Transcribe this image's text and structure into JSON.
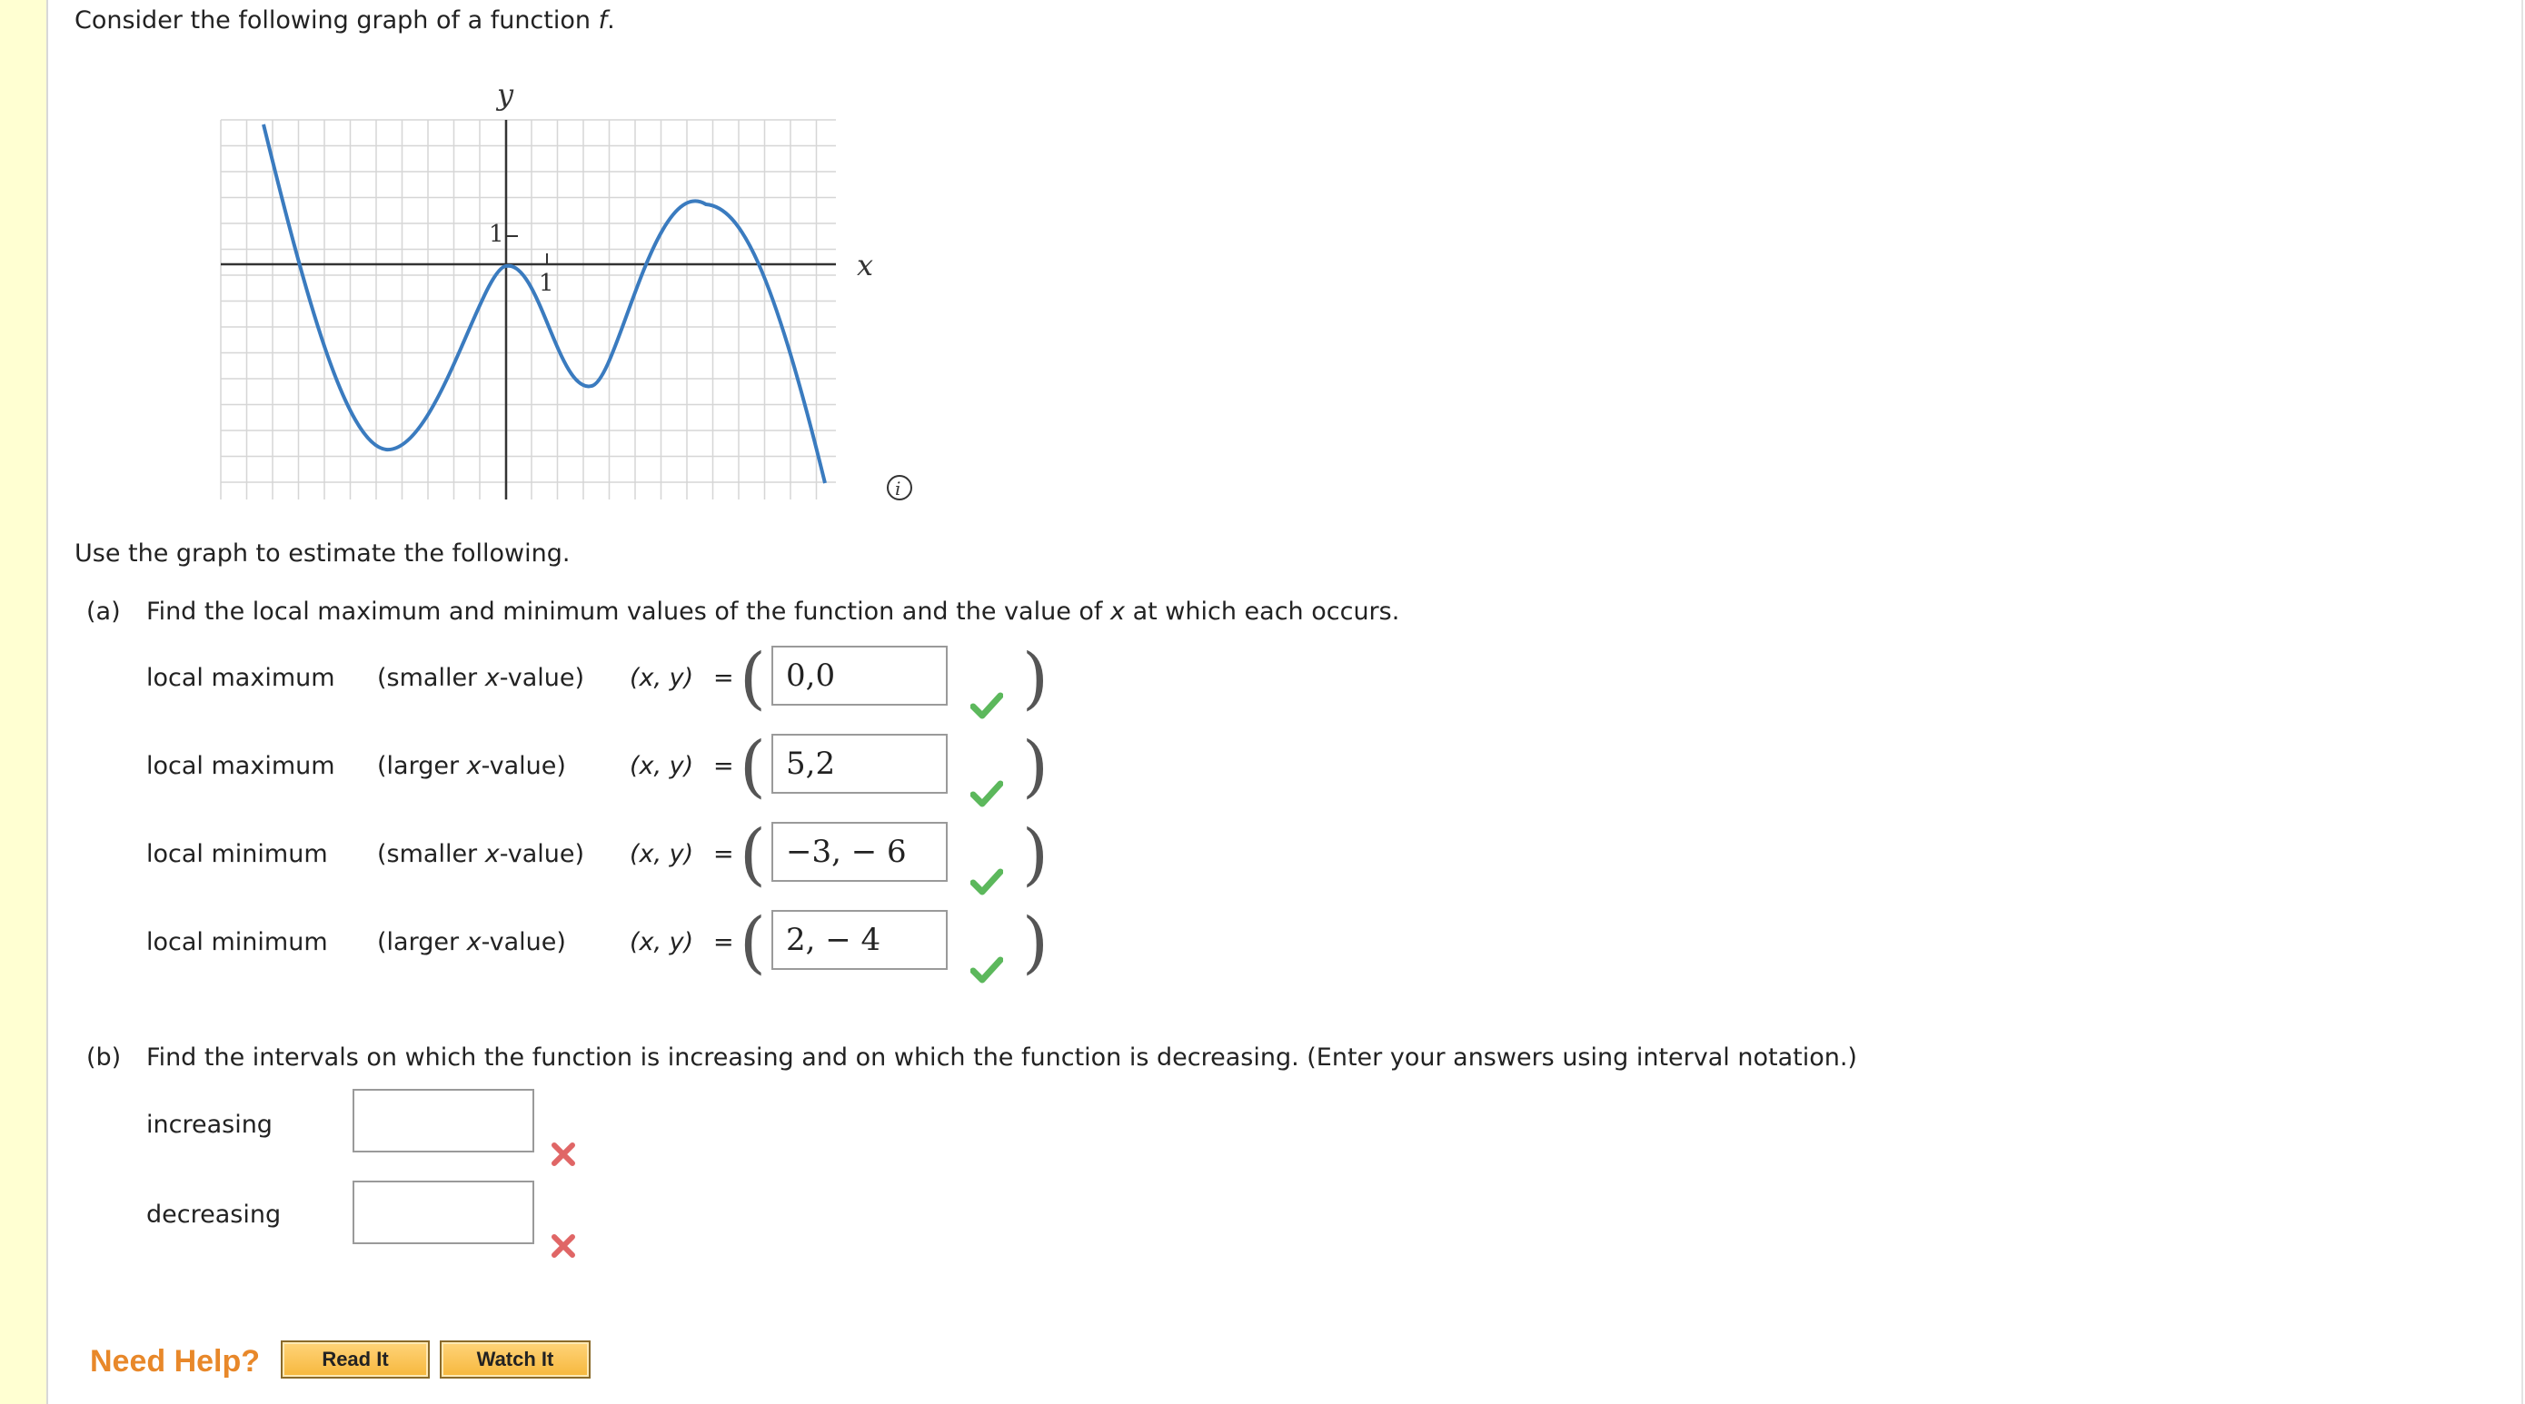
{
  "question": {
    "intro_text": "Consider the following graph of a function",
    "intro_var": "f",
    "intro_period": "."
  },
  "graph": {
    "y_label": "y",
    "x_label": "x",
    "tick_label_y": "1",
    "tick_label_x": "1",
    "curve_color": "#3a7bbf",
    "info_icon": "info-icon"
  },
  "instructions": "Use the graph to estimate the following.",
  "part_a": {
    "marker": "(a)",
    "text_before": "Find the local maximum and minimum values of the function and the value of",
    "text_var": "x",
    "text_after": "at which each occurs.",
    "rows": [
      {
        "kind": "local maximum",
        "which_open": "(smaller ",
        "which_var": "x",
        "which_close": "-value)",
        "xy_label": "(x, y)",
        "equals": "=",
        "value": "0,0",
        "status": "correct"
      },
      {
        "kind": "local maximum",
        "which_open": "(larger ",
        "which_var": "x",
        "which_close": "-value)",
        "xy_label": "(x, y)",
        "equals": "=",
        "value": "5,2",
        "status": "correct"
      },
      {
        "kind": "local minimum",
        "which_open": "(smaller ",
        "which_var": "x",
        "which_close": "-value)",
        "xy_label": "(x, y)",
        "equals": "=",
        "value": "−3, − 6",
        "status": "correct"
      },
      {
        "kind": "local minimum",
        "which_open": "(larger ",
        "which_var": "x",
        "which_close": "-value)",
        "xy_label": "(x, y)",
        "equals": "=",
        "value": "2, − 4",
        "status": "correct"
      }
    ]
  },
  "part_b": {
    "marker": "(b)",
    "text": "Find the intervals on which the function is increasing and on which the function is decreasing. (Enter your answers using interval notation.)",
    "increasing_label": "increasing",
    "decreasing_label": "decreasing",
    "increasing_value": "",
    "decreasing_value": "",
    "increasing_status": "incorrect",
    "decreasing_status": "incorrect"
  },
  "help": {
    "label": "Need Help?",
    "read_it": "Read It",
    "watch_it": "Watch It"
  },
  "colors": {
    "sidebar": "#ffffd2",
    "check": "#5cb85c",
    "cross": "#e06666",
    "help_text": "#e8882a",
    "button": "#f6b73c"
  }
}
